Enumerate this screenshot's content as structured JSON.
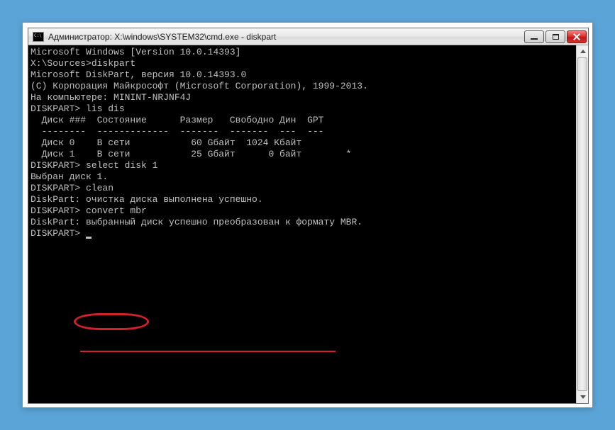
{
  "titlebar": {
    "text": "Администратор: X:\\windows\\SYSTEM32\\cmd.exe - diskpart"
  },
  "terminal": {
    "lines": [
      "Microsoft Windows [Version 10.0.14393]",
      "",
      "X:\\Sources>diskpart",
      "",
      "Microsoft DiskPart, версия 10.0.14393.0",
      "",
      "(C) Корпорация Майкрософт (Microsoft Corporation), 1999-2013.",
      "На компьютере: MININT-NRJNF4J",
      "",
      "DISKPART> lis dis",
      "",
      "  Диск ###  Состояние      Размер   Свободно Дин  GPT",
      "  --------  -------------  -------  -------  ---  ---",
      "  Диск 0    В сети           60 Gбайт  1024 Kбайт",
      "  Диск 1    В сети           25 Gбайт      0 байт        *",
      "",
      "DISKPART> select disk 1",
      "",
      "Выбран диск 1.",
      "",
      "DISKPART> clean",
      "",
      "DiskPart: очистка диска выполнена успешно.",
      "",
      "DISKPART> convert mbr",
      "",
      "DiskPart: выбранный диск успешно преобразован к формату MBR.",
      "",
      "DISKPART> "
    ]
  },
  "annotations": {
    "highlight_command": "convert mbr",
    "underlined_text": "выбранный диск успешно преобразован к формату MBR."
  },
  "buttons": {
    "minimize": "minimize",
    "maximize": "maximize",
    "close": "close"
  }
}
